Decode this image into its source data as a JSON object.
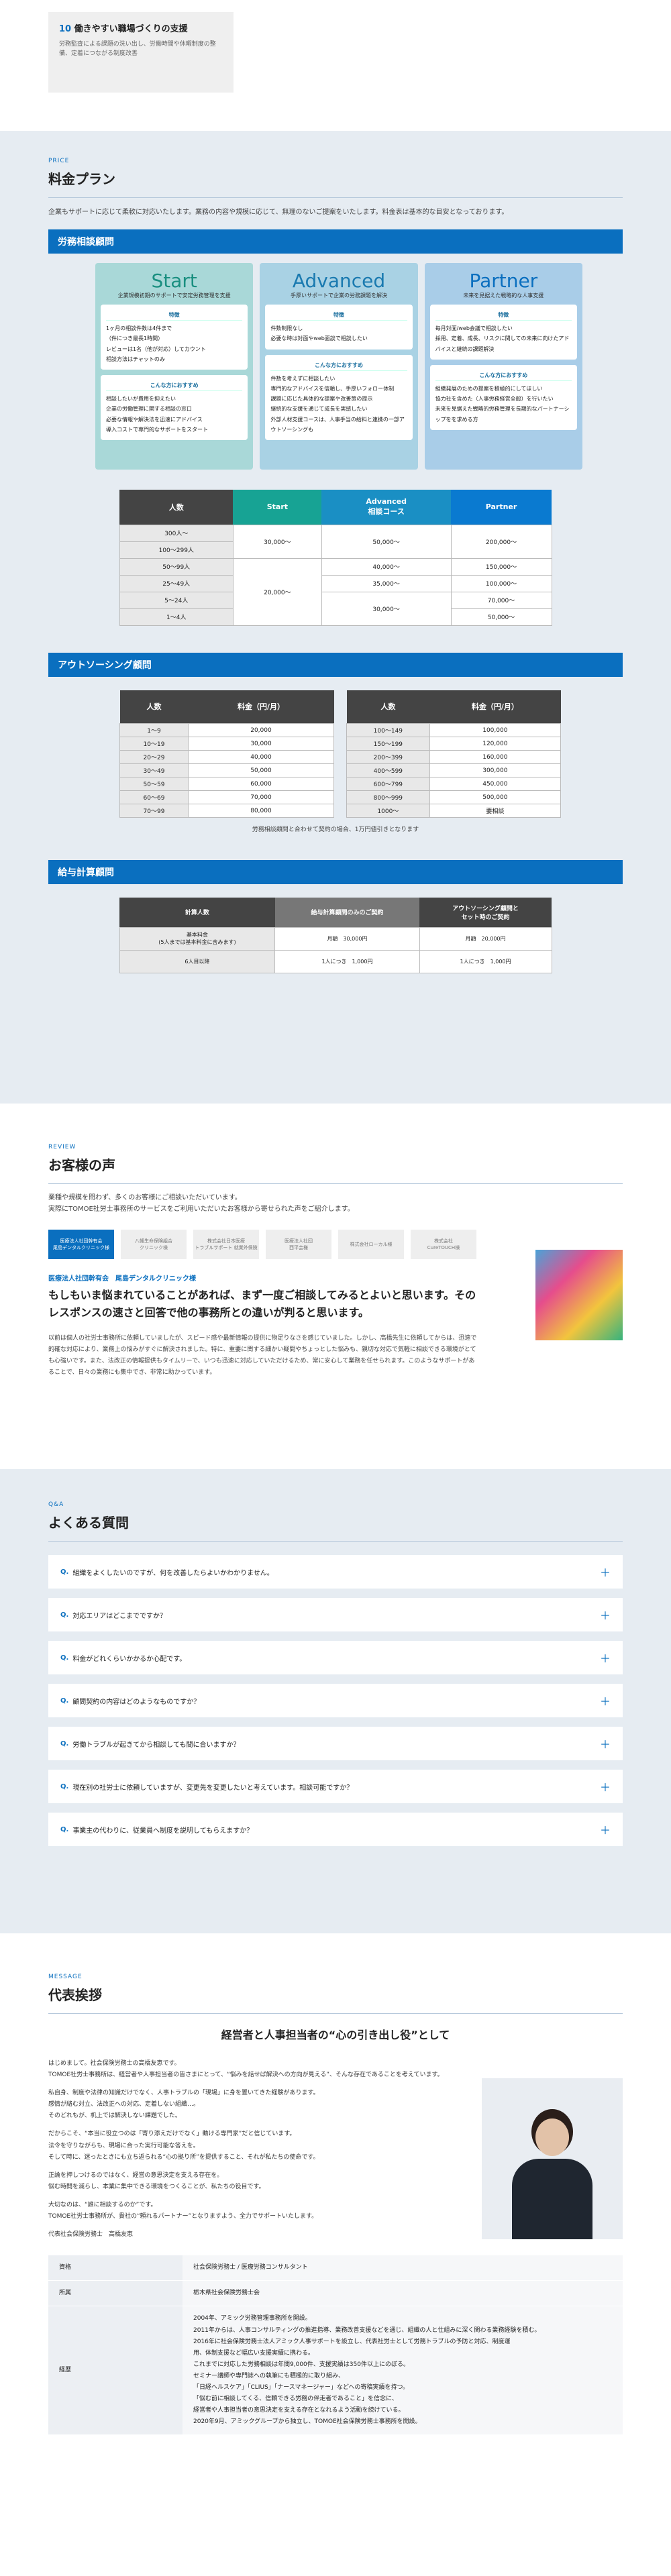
{
  "top_card": {
    "num": "10",
    "title": "働きやすい職場づくりの支援",
    "desc": "労務監査による課題の洗い出し、労働時間や休暇制度の整備、定着につながる制度改善"
  },
  "price": {
    "kicker": "PRICE",
    "title": "料金プラン",
    "lead": "企業もサポートに応じて柔軟に対応いたします。業務の内容や規模に応じて、無理のないご提案をいたします。料金表は基本的な目安となっております。",
    "band1": "労務相談顧問",
    "plans": [
      {
        "name": "Start",
        "sub": "企業規模初期のサポートで安定労務管理を支援",
        "feat_title": "特徴",
        "feats": [
          "1ヶ月の相談件数は4件まで",
          "（件につき最長1時間）",
          "レビューは1名（他が対応）してカウント",
          "相談方法はチャットのみ"
        ],
        "rec_title": "こんな方におすすめ",
        "recs": [
          "相談したいが費用を抑えたい",
          "企業の労働管理に関する相談の窓口",
          "必要な情報や解決法を迅速にアドバイス",
          "導入コストで専門的なサポートをスタート"
        ]
      },
      {
        "name": "Advanced",
        "sub": "手厚いサポートで企業の労務課題を解決",
        "feat_title": "特徴",
        "feats": [
          "件数制限なし",
          "必要な時は対面やweb面談で相談したい"
        ],
        "rec_title": "こんな方におすすめ",
        "recs": [
          "件数を考えずに相談したい",
          "専門的なアドバイスを信頼し、手厚いフォロー体制",
          "課題に応じた具体的な提案や改善策の提示",
          "継続的な支援を通じて成長を実感したい",
          "外部人材支援コースは、人事手当の給料と連携の一部アウトソーシングも"
        ]
      },
      {
        "name": "Partner",
        "sub": "未来を見据えた戦略的な人事支援",
        "feat_title": "特徴",
        "feats": [
          "毎月対面/web会議で相談したい",
          "採用、定着、成長、リスクに関しての未来に向けたアドバイスと継続の課題解決"
        ],
        "rec_title": "こんな方におすすめ",
        "recs": [
          "組織発展のための提案を積極的にしてほしい",
          "協力社を含めた（人事労務経営全般）を行いたい",
          "未来を見据えた戦略的労務管理を長期的なパートナーシップをを求める方"
        ]
      }
    ],
    "table": {
      "headers": [
        "人数",
        "Start",
        "Advanced\n相談コース",
        "Partner"
      ],
      "rows": [
        [
          "300人～",
          "30,000～",
          "50,000～",
          "200,000～"
        ],
        [
          "100～299人",
          "",
          "",
          ""
        ],
        [
          "50～99人",
          "",
          "40,000～",
          "150,000～"
        ],
        [
          "25～49人",
          "20,000～",
          "35,000～",
          "100,000～"
        ],
        [
          "5～24人",
          "",
          "30,000～",
          "70,000～"
        ],
        [
          "1～4人",
          "",
          "",
          "50,000～"
        ]
      ]
    },
    "band2": "アウトソーシング顧問",
    "ot_headers": [
      "人数",
      "料金（円/月）"
    ],
    "ot_left": [
      [
        "1～9",
        "20,000"
      ],
      [
        "10～19",
        "30,000"
      ],
      [
        "20～29",
        "40,000"
      ],
      [
        "30～49",
        "50,000"
      ],
      [
        "50～59",
        "60,000"
      ],
      [
        "60～69",
        "70,000"
      ],
      [
        "70～99",
        "80,000"
      ]
    ],
    "ot_right": [
      [
        "100～149",
        "100,000"
      ],
      [
        "150～199",
        "120,000"
      ],
      [
        "200～399",
        "160,000"
      ],
      [
        "400～599",
        "300,000"
      ],
      [
        "600～799",
        "450,000"
      ],
      [
        "800～999",
        "500,000"
      ],
      [
        "1000～",
        "要相談"
      ]
    ],
    "ot_note": "労務相談顧問と合わせて契約の場合、1万円値引きとなります",
    "band3": "給与計算顧問",
    "pay_headers": [
      "計算人数",
      "給与計算顧問のみのご契約",
      "アウトソーシング顧問と\nセット時のご契約"
    ],
    "pay_rows": [
      [
        "基本料金\n(5人までは基本料金に含みます)",
        "月額　30,000円",
        "月額　20,000円"
      ],
      [
        "6人目以降",
        "1人につき　1,000円",
        "1人につき　1,000円"
      ]
    ]
  },
  "review": {
    "kicker": "REVIEW",
    "title": "お客様の声",
    "lead": "業種や規模を問わず、多くのお客様にご相談いただいています。\n実際にTOMOE社労士事務所のサービスをご利用いただいたお客様から寄せられた声をご紹介します。",
    "tabs": [
      "医療法人社団幹有会\n尾島デンタルクリニック様",
      "八幡生命保険組合\nクリニック様",
      "株式会社日本医療\nトラブルサポート 就業外保険",
      "医療法人社団\n西平会様",
      "株式会社ローカル様 ",
      "株式会社\nCureTOUCH様"
    ],
    "clinic": "医療法人社団幹有会　尾島デンタルクリニック様",
    "headline": "もしもいま悩まれていることがあれば、まず一度ご相談してみるとよいと思います。そのレスポンスの速さと回答で他の事務所との違いが判ると思います。",
    "body": "以前は個人の社労士事務所に依頼していましたが、スピード感や最新情報の提供に物足りなさを感じていました。しかし、高橋先生に依頼してからは、迅速で的確な対応により、業務上の悩みがすぐに解決されました。特に、重要に関する細かい疑問やちょっとした悩みも、親切な対応で気軽に相談できる環境がとても心強いです。また、法改正の情報提供もタイムリーで、いつも迅速に対応していただけるため、常に安心して業務を任せられます。このようなサポートがあることで、日々の業務にも集中でき、非常に助かっています。"
  },
  "faq": {
    "kicker": "Q&A",
    "title": "よくある質問",
    "items": [
      "組織をよくしたいのですが、何を改善したらよいかわかりません。",
      "対応エリアはどこまでですか？",
      "料金がどれくらいかかるか心配です。",
      "顧問契約の内容はどのようなものですか？",
      "労働トラブルが起きてから相談しても間に合いますか？",
      "現在別の社労士に依頼していますが、変更先を変更したいと考えています。相談可能ですか？",
      "事業主の代わりに、従業員へ制度を説明してもらえますか？"
    ]
  },
  "message": {
    "kicker": "MESSAGE",
    "title": "代表挨拶",
    "headline": "経営者と人事担当者の“心の引き出し役”として",
    "paras": [
      "はじめまして。社会保険労務士の高橋友恵です。\nTOMOE社労士事務所は、経営者や人事担当者の皆さまにとって、“悩みを話せば解決への方向が見える”、そんな存在であることを考えています。",
      "私自身、制度や法律の知識だけでなく、人事トラブルの「現場」に身を置いてきた経験があります。\n感情が絡む対立、法改正への対応、定着しない組織…。\nそのどれもが、机上では解決しない課題でした。",
      "だからこそ、“本当に役立つのは「寄り添えだけでなく」動ける専門家”だと信じています。\n法令を守りながらも、現場に合った実行可能な答えを。\nそして時に、迷ったときにも立ち返られる“心の拠り所”を提供すること、それが私たちの使命です。",
      "正論を押しつけるのではなく、経営の意思決定を支える存在を。\n悩む時間を減らし、本業に集中できる環境をつくることが、私たちの役目です。",
      "大切なのは、“誰に相談するのか”です。\nTOMOE社労士事務所が、貴社の“頼れるパートナー”となりますよう、全力でサポートいたします。"
    ],
    "signature": "代表社会保険労務士　高橋友恵",
    "profile": [
      [
        "資格",
        "社会保険労務士 / 医療労務コンサルタント"
      ],
      [
        "所属",
        "栃木県社会保険労務士会"
      ],
      [
        "経歴",
        "2004年、アミック労務管理事務所を開設。\n2011年からは、人事コンサルティングの推進指導、業務改善支援などを通じ、組織の人と仕組みに深く関わる業務経験を積む。\n2016年に社会保険労務士法人アミック人事サポートを設立し、代表社労士として労務トラブルの予防と対応、制度運\n用、体制支援など幅広い支援実績に携わる。\nこれまでに対応した労務相談は年間9,000件、支援実績は350件以上にのぼる。\nセミナー講師や専門誌への執筆にも積極的に取り組み、\n「日経ヘルスケア」「CLIUS」「ナースマネージャー」などへの寄稿実績を持つ。\n「悩む前に相談してくる、信頼できる労務の伴走者であること」を信念に、\n経営者や人事担当者の意思決定を支える存在となれるよう活動を続けている。\n2020年9月、アミックグループから独立し、TOMOE社会保険労務士事務所を開設。"
      ]
    ]
  },
  "colors": {
    "accent": "#0a6fbf",
    "start": "#17a394",
    "advanced": "#1a8fc4",
    "partner": "#0a7ad0",
    "dark": "#444444"
  }
}
